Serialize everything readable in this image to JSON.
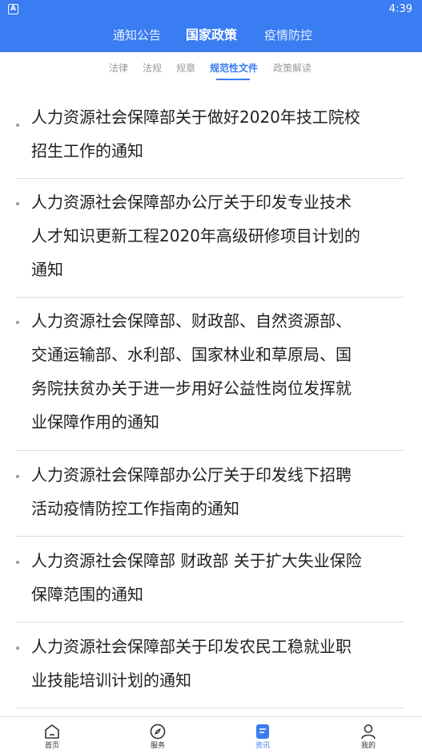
{
  "status_bar": {
    "badge": "A",
    "time": "4:39"
  },
  "top_tabs": [
    {
      "label": "通知公告",
      "active": false
    },
    {
      "label": "国家政策",
      "active": true
    },
    {
      "label": "疫情防控",
      "active": false
    }
  ],
  "sub_tabs": [
    {
      "label": "法律",
      "active": false
    },
    {
      "label": "法规",
      "active": false
    },
    {
      "label": "规章",
      "active": false
    },
    {
      "label": "规范性文件",
      "active": true
    },
    {
      "label": "政策解读",
      "active": false
    }
  ],
  "news": [
    {
      "lines": [
        "人力资源社会保障部关于做好2020年技工院校",
        "招生工作的通知"
      ]
    },
    {
      "lines": [
        "人力资源社会保障部办公厅关于印发专业技术",
        "人才知识更新工程2020年高级研修项目计划的",
        "通知"
      ]
    },
    {
      "lines": [
        "人力资源社会保障部、财政部、自然资源部、",
        "交通运输部、水利部、国家林业和草原局、国",
        "务院扶贫办关于进一步用好公益性岗位发挥就",
        "业保障作用的通知"
      ]
    },
    {
      "lines": [
        "人力资源社会保障部办公厅关于印发线下招聘",
        "活动疫情防控工作指南的通知"
      ]
    },
    {
      "lines": [
        "人力资源社会保障部 财政部 关于扩大失业保险",
        "保障范围的通知"
      ]
    },
    {
      "lines": [
        "人力资源社会保障部关于印发农民工稳就业职",
        "业技能培训计划的通知"
      ]
    }
  ],
  "bottom_nav": [
    {
      "label": "首页",
      "icon": "home-icon",
      "active": false
    },
    {
      "label": "服务",
      "icon": "compass-icon",
      "active": false
    },
    {
      "label": "资讯",
      "icon": "news-icon",
      "active": true
    },
    {
      "label": "我的",
      "icon": "user-icon",
      "active": false
    }
  ],
  "colors": {
    "brand": "#3a7cf2",
    "text": "#1f1f1f",
    "muted": "#9a9a9a",
    "divider": "#dcdcdc"
  }
}
